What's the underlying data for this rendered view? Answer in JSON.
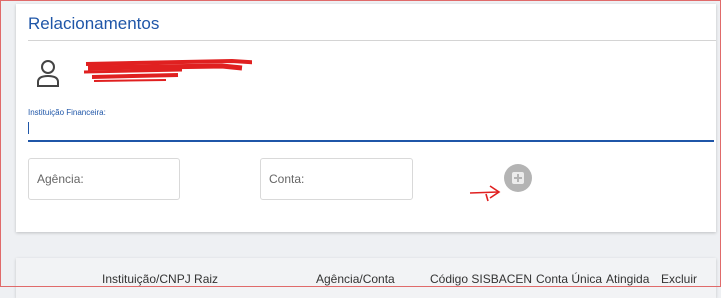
{
  "card": {
    "title": "Relacionamentos"
  },
  "redacted_name": "J...........................A",
  "financial_institution": {
    "label": "Instituição Financeira:",
    "value": ""
  },
  "agencia": {
    "placeholder": "Agência:",
    "value": ""
  },
  "conta": {
    "placeholder": "Conta:",
    "value": ""
  },
  "table": {
    "headers": [
      "Instituição/CNPJ Raiz",
      "Agência/Conta",
      "Código SISBACEN",
      "Conta Única",
      "Atingida",
      "Excluir"
    ]
  },
  "colors": {
    "accent": "#1f56a8",
    "annotation": "#e02020",
    "add_button": "#b4b4b4"
  },
  "icons": {
    "person": "person-outline-icon",
    "add": "plus-square-icon",
    "annotation": "red-arrow-annotation"
  }
}
